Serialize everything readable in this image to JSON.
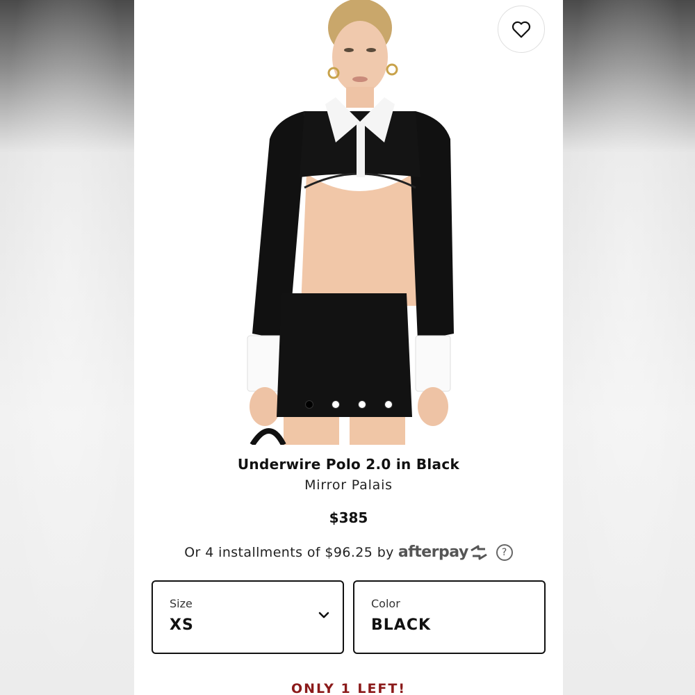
{
  "product": {
    "title": "Underwire Polo 2.0 in Black",
    "brand": "Mirror Palais",
    "price": "$385",
    "image_icon": "model-photo",
    "favorite_icon": "heart-icon"
  },
  "carousel": {
    "dot_count": 4,
    "active_index": 0
  },
  "payment": {
    "installments_text": "Or 4 installments of $96.25 by",
    "provider": "afterpay",
    "help_icon": "?"
  },
  "options": {
    "size": {
      "label": "Size",
      "value": "XS"
    },
    "color": {
      "label": "Color",
      "value": "BLACK"
    }
  },
  "stock": {
    "message": "ONLY 1 LEFT!"
  },
  "colors": {
    "stock_red": "#8b1a1a",
    "text": "#111111",
    "afterpay_gray": "#555555"
  }
}
